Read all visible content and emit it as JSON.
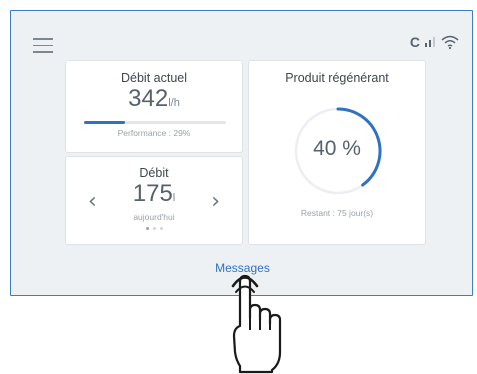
{
  "header": {
    "menu_icon": "hamburger-menu-icon",
    "status": {
      "connection_letter": "C",
      "signal_icon": "signal-bars-icon",
      "wifi_icon": "wifi-icon"
    }
  },
  "cards": {
    "debit_actuel": {
      "title": "Débit actuel",
      "value": "342",
      "unit": "l/h",
      "performance_label": "Performance : 29%",
      "performance_fraction": 0.29
    },
    "debit": {
      "title": "Débit",
      "value": "175",
      "unit": "l",
      "period": "aujourd'hui",
      "prev_icon": "chevron-left-icon",
      "next_icon": "chevron-right-icon",
      "page_count": 3,
      "active_page": 1
    },
    "produit_regenerant": {
      "title": "Produit régénérant",
      "percent_text": "40 %",
      "percent_fraction": 0.4,
      "remaining_label": "Restant : 75 jour(s)"
    }
  },
  "footer": {
    "messages_label": "Messages"
  },
  "overlay": {
    "pointer_icon": "hand-pointer-icon"
  },
  "colors": {
    "accent": "#2f72c2",
    "screen_border": "#3d7fc0",
    "screen_background": "#eef1f4"
  }
}
